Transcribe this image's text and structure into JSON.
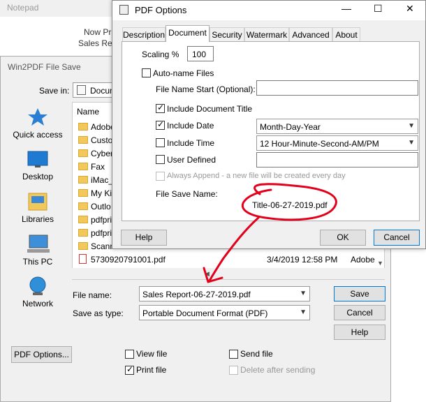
{
  "notepad": {
    "title": "Notepad",
    "line1": "Now Pri",
    "line2": "Sales Repo"
  },
  "save_dialog": {
    "title": "Win2PDF File Save",
    "save_in_label": "Save in:",
    "save_in_value": "Docum",
    "places": [
      {
        "label": "Quick access",
        "icon": "star-icon"
      },
      {
        "label": "Desktop",
        "icon": "desktop-icon"
      },
      {
        "label": "Libraries",
        "icon": "libraries-icon"
      },
      {
        "label": "This PC",
        "icon": "computer-icon"
      },
      {
        "label": "Network",
        "icon": "network-icon"
      }
    ],
    "file_list": {
      "header_name": "Name",
      "folders": [
        "Adobe",
        "Custo",
        "Cyber",
        "Fax",
        "iMac_",
        "My Ki",
        "Outlo",
        "pdfpri",
        "pdfpri",
        "Scann"
      ],
      "file": {
        "name": "5730920791001.pdf",
        "date": "3/4/2019 12:58 PM",
        "type": "Adobe"
      }
    },
    "file_name_label": "File name:",
    "file_name_value": "Sales Report-06-27-2019.pdf",
    "save_as_type_label": "Save as type:",
    "save_as_type_value": "Portable Document Format (PDF)",
    "save_button": "Save",
    "cancel_button": "Cancel",
    "help_button": "Help",
    "pdf_options_button": "PDF Options...",
    "view_file_label": "View file",
    "print_file_label": "Print file",
    "send_file_label": "Send file",
    "delete_after_sending_label": "Delete after sending",
    "view_file_checked": false,
    "print_file_checked": true,
    "send_file_checked": false
  },
  "pdf_options": {
    "title": "PDF Options",
    "tabs": [
      "Description",
      "Document",
      "Security",
      "Watermark",
      "Advanced",
      "About"
    ],
    "active_tab": "Document",
    "scaling_label": "Scaling %",
    "scaling_value": "100",
    "auto_name_label": "Auto-name Files",
    "file_name_start_label": "File Name Start (Optional):",
    "file_name_start_value": "",
    "include_title_label": "Include Document Title",
    "include_date_label": "Include Date",
    "date_format_value": "Month-Day-Year",
    "include_time_label": "Include Time",
    "time_format_value": "12 Hour-Minute-Second-AM/PM",
    "user_defined_label": "User Defined",
    "user_defined_value": "",
    "always_append_label": "Always Append - a new file will be created every day",
    "file_save_name_label": "File Save Name:",
    "file_save_name_value": "Title-06-27-2019.pdf",
    "help_button": "Help",
    "ok_button": "OK",
    "cancel_button": "Cancel",
    "minimize_glyph": "—",
    "maximize_glyph": "☐",
    "close_glyph": "✕"
  },
  "colors": {
    "annotation_red": "#e3001b",
    "accent_blue": "#0078d7"
  }
}
